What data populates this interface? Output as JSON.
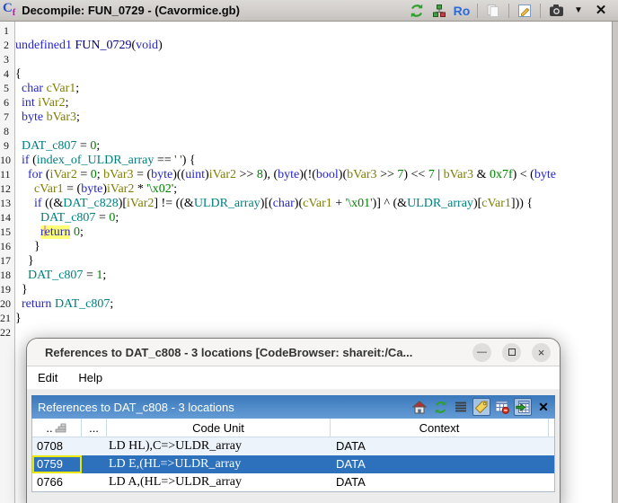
{
  "window": {
    "title": "Decompile: FUN_0729 -  (Cavormice.gb)",
    "toolbar": {
      "ro_label": "Ro"
    }
  },
  "decompiler": {
    "cursor_line": 15,
    "lines": [
      {
        "n": "1",
        "seg": []
      },
      {
        "n": "2",
        "seg": [
          [
            "k",
            "undefined1"
          ],
          [
            "p",
            " "
          ],
          [
            "f",
            "FUN_0729"
          ],
          [
            "p",
            "("
          ],
          [
            "k",
            "void"
          ],
          [
            "p",
            ")"
          ]
        ]
      },
      {
        "n": "3",
        "seg": []
      },
      {
        "n": "4",
        "seg": [
          [
            "p",
            "{"
          ]
        ]
      },
      {
        "n": "5",
        "seg": [
          [
            "p",
            "  "
          ],
          [
            "k",
            "char"
          ],
          [
            "p",
            " "
          ],
          [
            "v",
            "cVar1"
          ],
          [
            "p",
            ";"
          ]
        ]
      },
      {
        "n": "6",
        "seg": [
          [
            "p",
            "  "
          ],
          [
            "k",
            "int"
          ],
          [
            "p",
            " "
          ],
          [
            "v",
            "iVar2"
          ],
          [
            "p",
            ";"
          ]
        ]
      },
      {
        "n": "7",
        "seg": [
          [
            "p",
            "  "
          ],
          [
            "k",
            "byte"
          ],
          [
            "p",
            " "
          ],
          [
            "v",
            "bVar3"
          ],
          [
            "p",
            ";"
          ]
        ]
      },
      {
        "n": "8",
        "seg": []
      },
      {
        "n": "9",
        "seg": [
          [
            "p",
            "  "
          ],
          [
            "g",
            "DAT_c807"
          ],
          [
            "p",
            " = "
          ],
          [
            "c",
            "0"
          ],
          [
            "p",
            ";"
          ]
        ]
      },
      {
        "n": "10",
        "seg": [
          [
            "p",
            "  "
          ],
          [
            "k",
            "if"
          ],
          [
            "p",
            " ("
          ],
          [
            "g",
            "index_of_ULDR_array"
          ],
          [
            "p",
            " == "
          ],
          [
            "c",
            "' '"
          ],
          [
            "p",
            ") {"
          ]
        ]
      },
      {
        "n": "11",
        "seg": [
          [
            "p",
            "    "
          ],
          [
            "k",
            "for"
          ],
          [
            "p",
            " ("
          ],
          [
            "v",
            "iVar2"
          ],
          [
            "p",
            " = "
          ],
          [
            "c",
            "0"
          ],
          [
            "p",
            "; "
          ],
          [
            "v",
            "bVar3"
          ],
          [
            "p",
            " = ("
          ],
          [
            "k",
            "byte"
          ],
          [
            "p",
            ")(("
          ],
          [
            "k",
            "uint"
          ],
          [
            "p",
            ")"
          ],
          [
            "v",
            "iVar2"
          ],
          [
            "p",
            " >> "
          ],
          [
            "c",
            "8"
          ],
          [
            "p",
            "), ("
          ],
          [
            "k",
            "byte"
          ],
          [
            "p",
            ")(!("
          ],
          [
            "k",
            "bool"
          ],
          [
            "p",
            ")("
          ],
          [
            "v",
            "bVar3"
          ],
          [
            "p",
            " >> "
          ],
          [
            "c",
            "7"
          ],
          [
            "p",
            ") << "
          ],
          [
            "c",
            "7"
          ],
          [
            "p",
            " | "
          ],
          [
            "v",
            "bVar3"
          ],
          [
            "p",
            " & "
          ],
          [
            "c",
            "0x7f"
          ],
          [
            "p",
            ") < ("
          ],
          [
            "k",
            "byte"
          ]
        ]
      },
      {
        "n": "12",
        "seg": [
          [
            "p",
            "      "
          ],
          [
            "v",
            "cVar1"
          ],
          [
            "p",
            " = ("
          ],
          [
            "k",
            "byte"
          ],
          [
            "p",
            ")"
          ],
          [
            "v",
            "iVar2"
          ],
          [
            "p",
            " * "
          ],
          [
            "c",
            "'\\x02'"
          ],
          [
            "p",
            ";"
          ]
        ]
      },
      {
        "n": "13",
        "seg": [
          [
            "p",
            "      "
          ],
          [
            "k",
            "if"
          ],
          [
            "p",
            " ((&"
          ],
          [
            "g",
            "DAT_c828"
          ],
          [
            "p",
            ")["
          ],
          [
            "v",
            "iVar2"
          ],
          [
            "p",
            "] != ((&"
          ],
          [
            "g",
            "ULDR_array"
          ],
          [
            "p",
            ")[("
          ],
          [
            "k",
            "char"
          ],
          [
            "p",
            ")("
          ],
          [
            "v",
            "cVar1"
          ],
          [
            "p",
            " + "
          ],
          [
            "c",
            "'\\x01'"
          ],
          [
            "p",
            ")] ^ (&"
          ],
          [
            "g",
            "ULDR_array"
          ],
          [
            "p",
            ")["
          ],
          [
            "v",
            "cVar1"
          ],
          [
            "p",
            "])) {"
          ]
        ]
      },
      {
        "n": "14",
        "seg": [
          [
            "p",
            "        "
          ],
          [
            "g",
            "DAT_c807"
          ],
          [
            "p",
            " = "
          ],
          [
            "c",
            "0"
          ],
          [
            "p",
            ";"
          ]
        ]
      },
      {
        "n": "15",
        "seg": [
          [
            "p",
            "        "
          ],
          [
            "hl",
            "return"
          ],
          [
            "p",
            " "
          ],
          [
            "c",
            "0"
          ],
          [
            "p",
            ";"
          ]
        ]
      },
      {
        "n": "16",
        "seg": [
          [
            "p",
            "      }"
          ]
        ]
      },
      {
        "n": "17",
        "seg": [
          [
            "p",
            "    }"
          ]
        ]
      },
      {
        "n": "18",
        "seg": [
          [
            "p",
            "    "
          ],
          [
            "g",
            "DAT_c807"
          ],
          [
            "p",
            " = "
          ],
          [
            "c",
            "1"
          ],
          [
            "p",
            ";"
          ]
        ]
      },
      {
        "n": "19",
        "seg": [
          [
            "p",
            "  }"
          ]
        ]
      },
      {
        "n": "20",
        "seg": [
          [
            "p",
            "  "
          ],
          [
            "k",
            "return"
          ],
          [
            "p",
            " "
          ],
          [
            "g",
            "DAT_c807"
          ],
          [
            "p",
            ";"
          ]
        ]
      },
      {
        "n": "21",
        "seg": [
          [
            "p",
            "}"
          ]
        ]
      },
      {
        "n": "22",
        "seg": []
      }
    ]
  },
  "dialog": {
    "title": "References to DAT_c808 - 3 locations [CodeBrowser: shareit:/Ca...",
    "menu": [
      "Edit",
      "Help"
    ],
    "panel_title": "References to DAT_c808 - 3 locations",
    "table": {
      "columns": [
        "..",
        "...",
        "Code Unit",
        "Context"
      ],
      "rows": [
        {
          "location": "0708",
          "code_unit": "LD HL),C=>ULDR_array",
          "context": "DATA",
          "selected": false,
          "stripe": true
        },
        {
          "location": "0759",
          "code_unit": "LD E,(HL=>ULDR_array",
          "context": "DATA",
          "selected": true,
          "stripe": false
        },
        {
          "location": "0766",
          "code_unit": "LD A,(HL=>ULDR_array",
          "context": "DATA",
          "selected": false,
          "stripe": false
        }
      ]
    }
  },
  "colors": {
    "selection_blue": "#2d71bd",
    "row_stripe": "#edf3fb",
    "cursor_highlight": "#ffff78",
    "panel_header_top": "#3a78bc",
    "panel_header_bottom": "#659cd5",
    "syntax_keyword": "#2626cc",
    "syntax_function": "#00008b",
    "syntax_global": "#008080",
    "syntax_variable": "#7f7f00",
    "syntax_constant": "#008000"
  }
}
